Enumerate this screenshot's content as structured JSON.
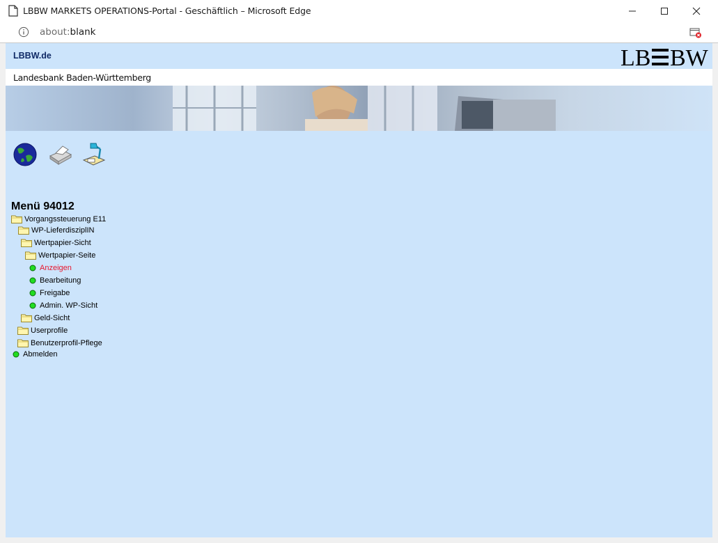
{
  "window": {
    "title": "LBBW MARKETS OPERATIONS-Portal - Geschäftlich – Microsoft Edge",
    "url_prefix": "about:",
    "url_host": "blank"
  },
  "header": {
    "link": "LBBW.de",
    "logo": "LB☰BW",
    "bank_name": "Landesbank Baden-Württemberg"
  },
  "toolbar": {
    "icons": [
      "globe-icon",
      "printer-icon",
      "desk-lamp-icon"
    ]
  },
  "menu": {
    "title": "Menü 94012",
    "items": [
      {
        "label": "Vorgangssteuerung E11",
        "type": "folder"
      },
      {
        "label": "WP-LieferdisziplIN",
        "type": "folder"
      },
      {
        "label": "Wertpapier-Sicht",
        "type": "folder"
      },
      {
        "label": "Wertpapier-Seite",
        "type": "folder"
      },
      {
        "label": "Anzeigen",
        "type": "leaf",
        "active": true
      },
      {
        "label": "Bearbeitung",
        "type": "leaf"
      },
      {
        "label": "Freigabe",
        "type": "leaf"
      },
      {
        "label": "Admin. WP-Sicht",
        "type": "leaf"
      },
      {
        "label": "Geld-Sicht",
        "type": "folder"
      },
      {
        "label": "Userprofile",
        "type": "folder"
      },
      {
        "label": "Benutzerprofil-Pflege",
        "type": "folder"
      },
      {
        "label": "Abmelden",
        "type": "leaf"
      }
    ]
  },
  "colors": {
    "page_bg": "#cce4fb",
    "active_item": "#e8162d",
    "link": "#102a66",
    "leaf_dot": "#22dd22",
    "folder": "#fff0a0"
  }
}
